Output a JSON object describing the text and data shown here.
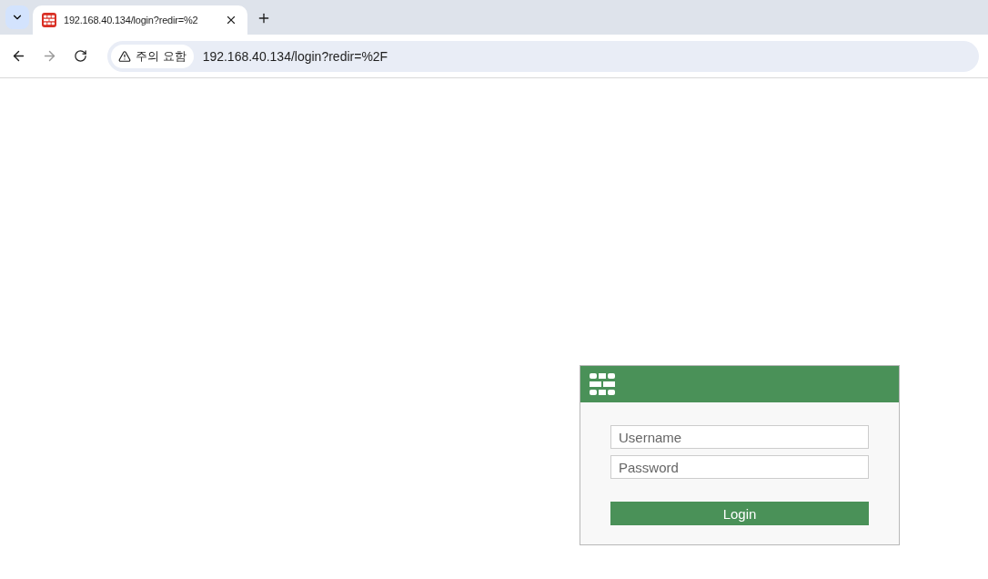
{
  "tabs": [
    {
      "title": "192.168.40.134/login?redir=%2",
      "selected": true
    }
  ],
  "address_bar": {
    "security_label": "주의 요함",
    "url": "192.168.40.134/login?redir=%2F"
  },
  "login": {
    "username_placeholder": "Username",
    "password_placeholder": "Password",
    "button": "Login"
  }
}
